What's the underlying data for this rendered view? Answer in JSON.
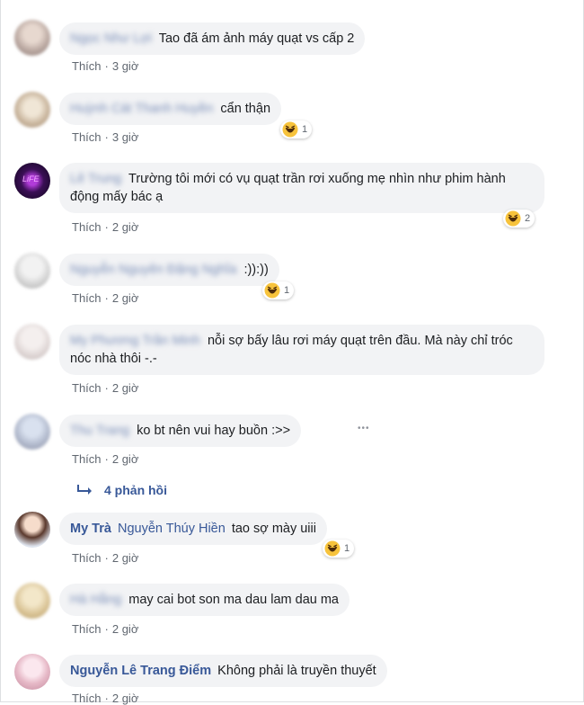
{
  "comments": [
    {
      "name": "Ngọc Như Lợi",
      "text": "Tao đã ám ảnh máy quạt vs cấp 2",
      "like": "Thích",
      "time": "3 giờ",
      "reactions": ""
    },
    {
      "name": "Huỳnh Cát Thanh Huyền",
      "text": "cẩn thận",
      "like": "Thích",
      "time": "3 giờ",
      "reactions": "1"
    },
    {
      "name": "Lê Trung",
      "text": "Trường tôi mới có vụ quạt trần rơi xuống mẹ nhìn như phim hành động mấy bác ạ",
      "like": "Thích",
      "time": "2 giờ",
      "reactions": "2"
    },
    {
      "name": "Nguyễn Nguyên Đặng Nghĩa",
      "text": ":)):))",
      "like": "Thích",
      "time": "2 giờ",
      "reactions": "1"
    },
    {
      "name": "My Phương Trần Minh",
      "text": "nỗi sợ bấy lâu rơi máy quạt trên đầu. Mà này chỉ tróc nóc nhà thôi -.-",
      "like": "Thích",
      "time": "2 giờ",
      "reactions": ""
    },
    {
      "name": "Thu Trang",
      "text": "ko bt nên vui hay buồn :>>",
      "like": "Thích",
      "time": "2 giờ",
      "reactions": ""
    },
    {
      "name": "My Trà",
      "tag": "Nguyễn Thúy Hiền",
      "text": "tao sợ mày uiii",
      "like": "Thích",
      "time": "2 giờ",
      "reactions": "1"
    },
    {
      "name": "Hà Hằng",
      "text": "may cai bot son ma dau lam dau ma",
      "like": "Thích",
      "time": "2 giờ",
      "reactions": ""
    },
    {
      "name": "Nguyễn Lê Trang Điểm",
      "text": "Không phải là truyền thuyết",
      "like": "Thích",
      "time": "2 giờ",
      "reactions": ""
    }
  ],
  "replies_label": "4 phản hồi",
  "more_label": "•••",
  "colors": {
    "link": "#385898",
    "bubble": "#f2f3f5",
    "meta": "#606770"
  },
  "icons": {
    "reaction": "haha-icon",
    "reply": "reply-arrow-icon"
  }
}
